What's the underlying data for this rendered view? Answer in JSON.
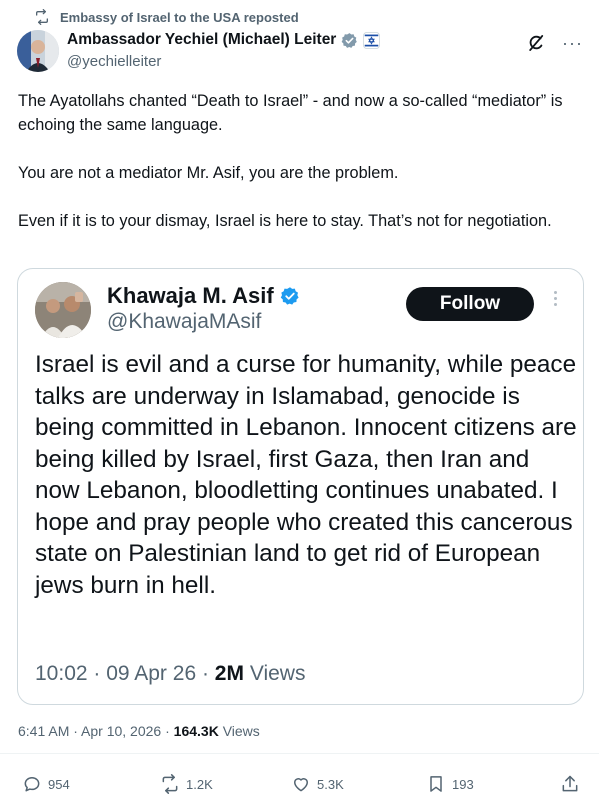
{
  "repost_banner": {
    "text": "Embassy of Israel to the USA reposted",
    "icon": "repost-icon"
  },
  "author": {
    "name": "Ambassador Yechiel (Michael) Leiter",
    "handle": "@yechielleiter",
    "verified_color": "#829aab"
  },
  "tweet": {
    "paragraphs": [
      "The Ayatollahs chanted “Death to Israel” - and now a so-called “mediator” is echoing the same language.",
      "You are not a mediator Mr. Asif, you are the problem.",
      "Even if it is to your dismay, Israel is here to stay. That’s not for negotiation."
    ],
    "time": "6:41 AM · Apr 10, 2026 · ",
    "views_count": "164.3K",
    "views_label": " Views"
  },
  "quoted": {
    "name": "Khawaja M. Asif",
    "handle": "@KhawajaMAsif",
    "follow_label": "Follow",
    "text": "Israel is evil and a curse for humanity, while peace talks are underway in Islamabad, genocide is being committed in Lebanon. Innocent citizens are being killed by Israel, first Gaza, then Iran and now Lebanon, bloodletting continues unabated. I hope and pray people who created this cancerous state on Palestinian land to get rid of European jews burn in hell.",
    "time": "10:02 · 09 Apr 26 · ",
    "views_count": "2M",
    "views_label": " Views",
    "verified_color": "#1d9bf0"
  },
  "actions": {
    "replies": "954",
    "reposts": "1.2K",
    "likes": "5.3K",
    "bookmarks": "193"
  }
}
